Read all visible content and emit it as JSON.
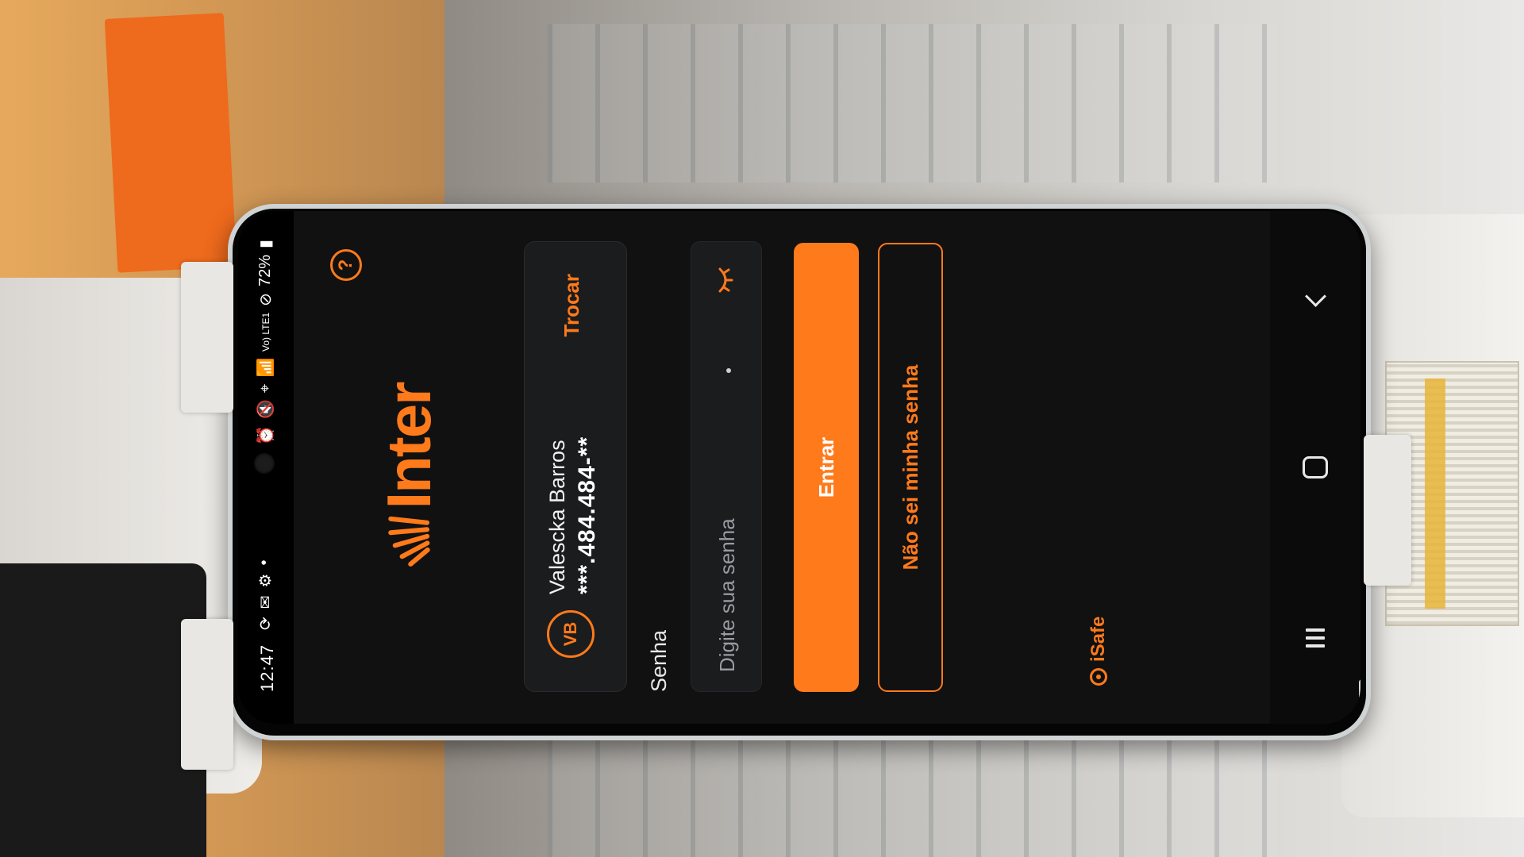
{
  "status_bar": {
    "time": "12:47",
    "battery": "72%",
    "network": "Vo) LTE1"
  },
  "help": {
    "label": "?"
  },
  "brand": {
    "logo_text": "Inter",
    "accent_color": "#ff7a1a"
  },
  "account": {
    "avatar_initials": "VB",
    "name": "Valescka Barros",
    "document": "***.484.484-**",
    "switch_label": "Trocar"
  },
  "password": {
    "label": "Senha",
    "placeholder": "Digite sua senha",
    "value": ""
  },
  "actions": {
    "enter_label": "Entrar",
    "forgot_label": "Não sei minha senha"
  },
  "footer": {
    "isafe_label": "iSafe"
  },
  "icons": {
    "help": "help-icon",
    "eye": "eye-closed-icon",
    "isafe": "isafe-icon",
    "nav_recent": "recent-apps-icon",
    "nav_home": "home-icon",
    "nav_back": "back-icon"
  }
}
